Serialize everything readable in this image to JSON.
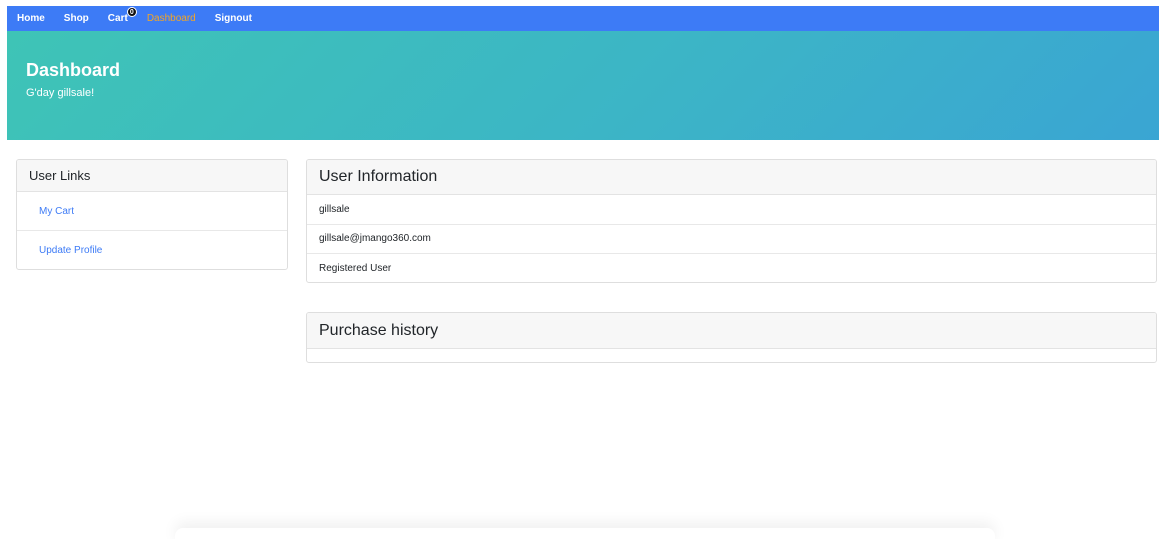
{
  "nav": {
    "items": [
      {
        "label": "Home"
      },
      {
        "label": "Shop"
      },
      {
        "label": "Cart",
        "badge": "0"
      },
      {
        "label": "Dashboard"
      },
      {
        "label": "Signout"
      }
    ],
    "active": "Dashboard",
    "colors": {
      "bar": "#3d7bf6",
      "active": "#f5a623"
    }
  },
  "hero": {
    "title": "Dashboard",
    "greeting": "G'day gillsale!"
  },
  "user_links": {
    "title": "User Links",
    "items": [
      {
        "label": "My Cart"
      },
      {
        "label": "Update Profile"
      }
    ]
  },
  "user_info": {
    "title": "User Information",
    "rows": [
      {
        "value": "gillsale"
      },
      {
        "value": "gillsale@jmango360.com"
      },
      {
        "value": "Registered User"
      }
    ]
  },
  "purchase_history": {
    "title": "Purchase history"
  }
}
